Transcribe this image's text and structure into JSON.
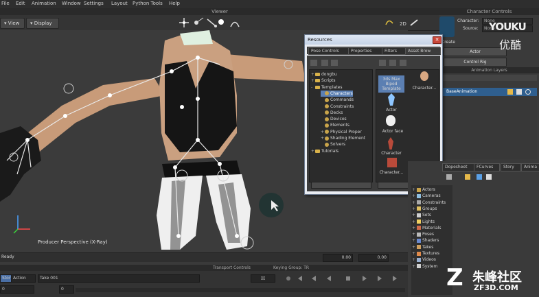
{
  "menu": [
    "File",
    "Edit",
    "Animation",
    "Window",
    "Settings",
    "Layout",
    "Python Tools",
    "Help"
  ],
  "viewer": {
    "title": "Viewer",
    "view_btn": "View",
    "display_btn": "Display",
    "label": "Producer Perspective (X-Ray)",
    "mode_2d": "2D"
  },
  "character_controls": {
    "title": "Character Controls",
    "character_label": "Character:",
    "character_value": "None",
    "source_label": "Source:",
    "source_value": "None",
    "create_label": "Create",
    "actor_btn": "Actor",
    "control_rig_btn": "Control Rig"
  },
  "animation_layers": {
    "title": "Animation Layers",
    "base": "BaseAnimation"
  },
  "resources": {
    "title": "Resources",
    "tabs": [
      "Pose Controls",
      "Properties",
      "Filters",
      "Asset Brow"
    ],
    "tree": [
      {
        "label": "dongbu",
        "depth": 0,
        "icon": "folder",
        "exp": "+"
      },
      {
        "label": "Scripts",
        "depth": 0,
        "icon": "folder",
        "exp": "+"
      },
      {
        "label": "Templates",
        "depth": 0,
        "icon": "folder",
        "exp": "-"
      },
      {
        "label": "Characters",
        "depth": 1,
        "icon": "gear",
        "exp": "",
        "selected": true
      },
      {
        "label": "Commands",
        "depth": 1,
        "icon": "gear",
        "exp": ""
      },
      {
        "label": "Constraints",
        "depth": 1,
        "icon": "gear",
        "exp": ""
      },
      {
        "label": "Decks",
        "depth": 1,
        "icon": "gear",
        "exp": ""
      },
      {
        "label": "Devices",
        "depth": 1,
        "icon": "gear",
        "exp": ""
      },
      {
        "label": "Elements",
        "depth": 1,
        "icon": "gear",
        "exp": ""
      },
      {
        "label": "Physical Proper",
        "depth": 1,
        "icon": "gear",
        "exp": "+"
      },
      {
        "label": "Shading Element",
        "depth": 1,
        "icon": "gear",
        "exp": "+"
      },
      {
        "label": "Solvers",
        "depth": 1,
        "icon": "gear",
        "exp": ""
      },
      {
        "label": "Tutorials",
        "depth": 0,
        "icon": "folder",
        "exp": "+"
      }
    ],
    "assets": [
      {
        "label": "3ds Max Biped Template",
        "selected": true
      },
      {
        "label": "Character..."
      },
      {
        "label": "Actor"
      },
      {
        "label": "Actor face"
      },
      {
        "label": "Character"
      },
      {
        "label": "Character..."
      }
    ]
  },
  "lower_right": {
    "tabs": [
      "Dopesheet",
      "FCurves",
      "Story",
      "Anima"
    ],
    "items": [
      {
        "label": "Actors",
        "icon": "actor"
      },
      {
        "label": "Cameras",
        "icon": "camera"
      },
      {
        "label": "Constraints",
        "icon": "constraint"
      },
      {
        "label": "Groups",
        "icon": "group"
      },
      {
        "label": "Sets",
        "icon": "set"
      },
      {
        "label": "Lights",
        "icon": "light"
      },
      {
        "label": "Materials",
        "icon": "material"
      },
      {
        "label": "Poses",
        "icon": "pose"
      },
      {
        "label": "Shaders",
        "icon": "shader"
      },
      {
        "label": "Takes",
        "icon": "take"
      },
      {
        "label": "Textures",
        "icon": "texture"
      },
      {
        "label": "Videos",
        "icon": "video"
      },
      {
        "label": "System",
        "icon": "system"
      }
    ]
  },
  "status": {
    "ready": "Ready",
    "time_a": "0.00",
    "time_b": "0.00"
  },
  "transport": {
    "title": "Transport Controls",
    "keying_group": "Keying Group: TR",
    "story_btn": "Story",
    "action_label": "Action",
    "take_value": "Take 001",
    "frame_a": "0",
    "frame_b": "0"
  },
  "watermarks": {
    "youku": "YOUKU",
    "youku_cn": "优酷",
    "zf3d_cn": "朱峰社区",
    "zf3d_en": "ZF3D.COM"
  }
}
